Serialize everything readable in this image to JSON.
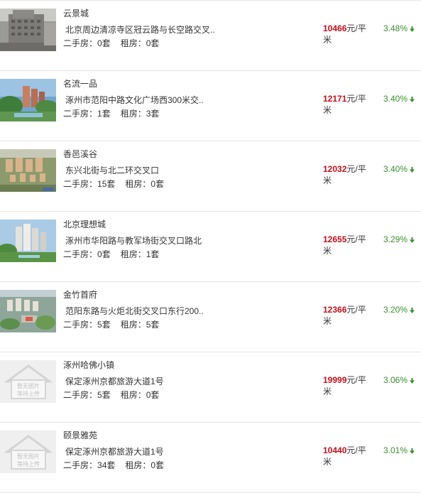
{
  "colors": {
    "price": "#c50d18",
    "change_down": "#3a8f2c",
    "divider": "#e4e4e4"
  },
  "listings": [
    {
      "name": "云景城",
      "address": "北京周边清凉寺区冠云路与长空路交叉..",
      "resale_label": "二手房：",
      "resale_count": "0套",
      "rent_label": "租房：",
      "rent_count": "0套",
      "price": "10466",
      "price_unit": "元/平米",
      "change": "3.48%",
      "change_icon": "arrow-down-icon",
      "thumb": "building-photo"
    },
    {
      "name": "名流一品",
      "address": "涿州市范阳中路文化广场西300米交..",
      "resale_label": "二手房：",
      "resale_count": "1套",
      "rent_label": "租房：",
      "rent_count": "3套",
      "price": "12171",
      "price_unit": "元/平米",
      "change": "3.40%",
      "change_icon": "arrow-down-icon",
      "thumb": "rendering-photo"
    },
    {
      "name": "香邑溪谷",
      "address": "东兴北街与北二环交叉口",
      "resale_label": "二手房：",
      "resale_count": "15套",
      "rent_label": "租房：",
      "rent_count": "0套",
      "price": "12032",
      "price_unit": "元/平米",
      "change": "3.40%",
      "change_icon": "arrow-down-icon",
      "thumb": "aerial-photo"
    },
    {
      "name": "北京理想城",
      "address": "涿州市华阳路与教军场街交叉口路北",
      "resale_label": "二手房：",
      "resale_count": "0套",
      "rent_label": "租房：",
      "rent_count": "1套",
      "price": "12655",
      "price_unit": "元/平米",
      "change": "3.29%",
      "change_icon": "arrow-down-icon",
      "thumb": "towers-photo"
    },
    {
      "name": "金竹首府",
      "address": "范阳东路与火炬北街交叉口东行200..",
      "resale_label": "二手房：",
      "resale_count": "5套",
      "rent_label": "租房：",
      "rent_count": "5套",
      "price": "12366",
      "price_unit": "元/平米",
      "change": "3.20%",
      "change_icon": "arrow-down-icon",
      "thumb": "aerial-photo-2"
    },
    {
      "name": "涿州哈佛小镇",
      "address": "保定涿州京都旅游大道1号",
      "resale_label": "二手房：",
      "resale_count": "5套",
      "rent_label": "租房：",
      "rent_count": "0套",
      "price": "19999",
      "price_unit": "元/平米",
      "change": "3.06%",
      "change_icon": "arrow-down-icon",
      "thumb": "placeholder",
      "placeholder_line1": "暂无图片",
      "placeholder_line2": "等待上传"
    },
    {
      "name": "颐景雅苑",
      "address": "保定涿州京都旅游大道1号",
      "resale_label": "二手房：",
      "resale_count": "34套",
      "rent_label": "租房：",
      "rent_count": "0套",
      "price": "10440",
      "price_unit": "元/平米",
      "change": "3.01%",
      "change_icon": "arrow-down-icon",
      "thumb": "placeholder",
      "placeholder_line1": "暂无图片",
      "placeholder_line2": "等待上传"
    }
  ]
}
